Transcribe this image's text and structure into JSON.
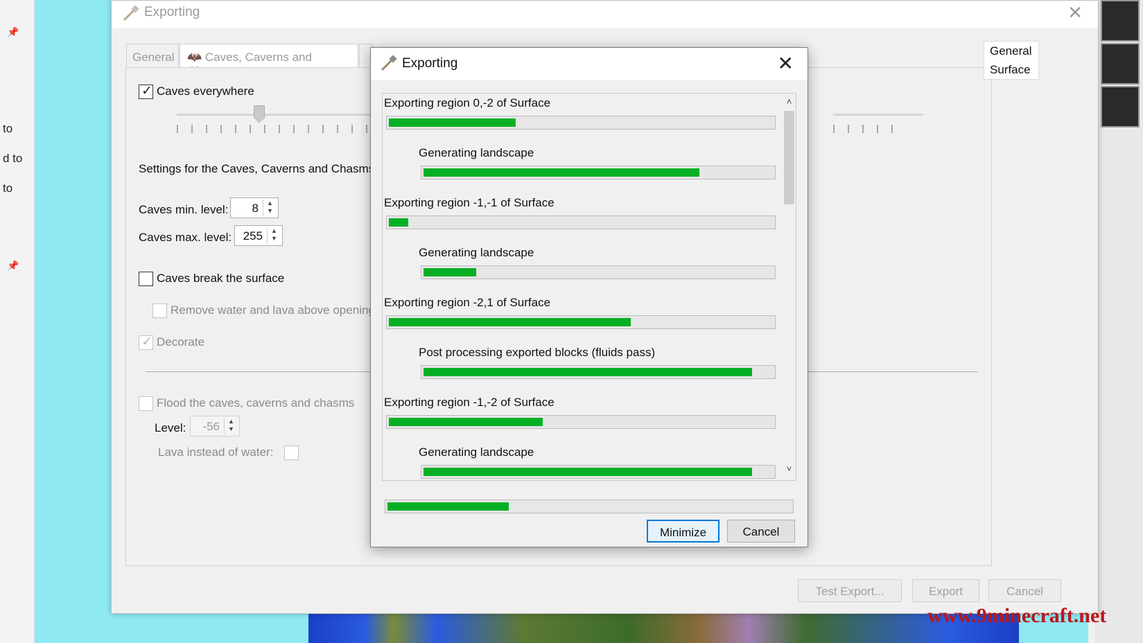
{
  "background": {
    "left_trails": [
      "to",
      "d to",
      "to"
    ]
  },
  "settings_window": {
    "title": "Exporting",
    "tabs": [
      "General",
      "Caves, Caverns and Chasms"
    ],
    "caves_everywhere_label": "Caves everywhere",
    "caves_everywhere_checked": true,
    "section_label": "Settings for the Caves, Caverns and Chasms",
    "caves_min_label": "Caves min. level:",
    "caves_min_value": "8",
    "caves_max_label": "Caves max. level:",
    "caves_max_value": "255",
    "break_surface_label": "Caves break the surface",
    "break_surface_checked": false,
    "remove_water_label": "Remove water and lava above openings",
    "decorate_label": "Decorate",
    "flood_label": "Flood the caves, caverns and chasms",
    "level_label": "Level:",
    "level_value": "-56",
    "lava_label": "Lava instead of water:",
    "side_list": [
      "General",
      "Surface"
    ],
    "buttons": {
      "test_export": "Test Export...",
      "export": "Export",
      "cancel": "Cancel"
    }
  },
  "progress_dialog": {
    "title": "Exporting",
    "tasks": [
      {
        "label": "Exporting region 0,-2 of Surface",
        "progress": 0.33,
        "level": 0
      },
      {
        "label": "Generating landscape",
        "progress": 0.79,
        "level": 1
      },
      {
        "label": "Exporting region -1,-1 of Surface",
        "progress": 0.05,
        "level": 0
      },
      {
        "label": "Generating landscape",
        "progress": 0.15,
        "level": 1
      },
      {
        "label": "Exporting region -2,1 of Surface",
        "progress": 0.63,
        "level": 0
      },
      {
        "label": "Post processing exported blocks (fluids pass)",
        "progress": 0.94,
        "level": 1
      },
      {
        "label": "Exporting region -1,-2 of Surface",
        "progress": 0.4,
        "level": 0
      },
      {
        "label": "Generating landscape",
        "progress": 0.94,
        "level": 1
      }
    ],
    "overall_progress": 0.3,
    "minimize_label": "Minimize",
    "cancel_label": "Cancel"
  },
  "watermark": "www.9minecraft.net",
  "colors": {
    "progress_green": "#06b025",
    "cyan_background": "#8fe9f3",
    "watermark_red": "#b8171b"
  }
}
